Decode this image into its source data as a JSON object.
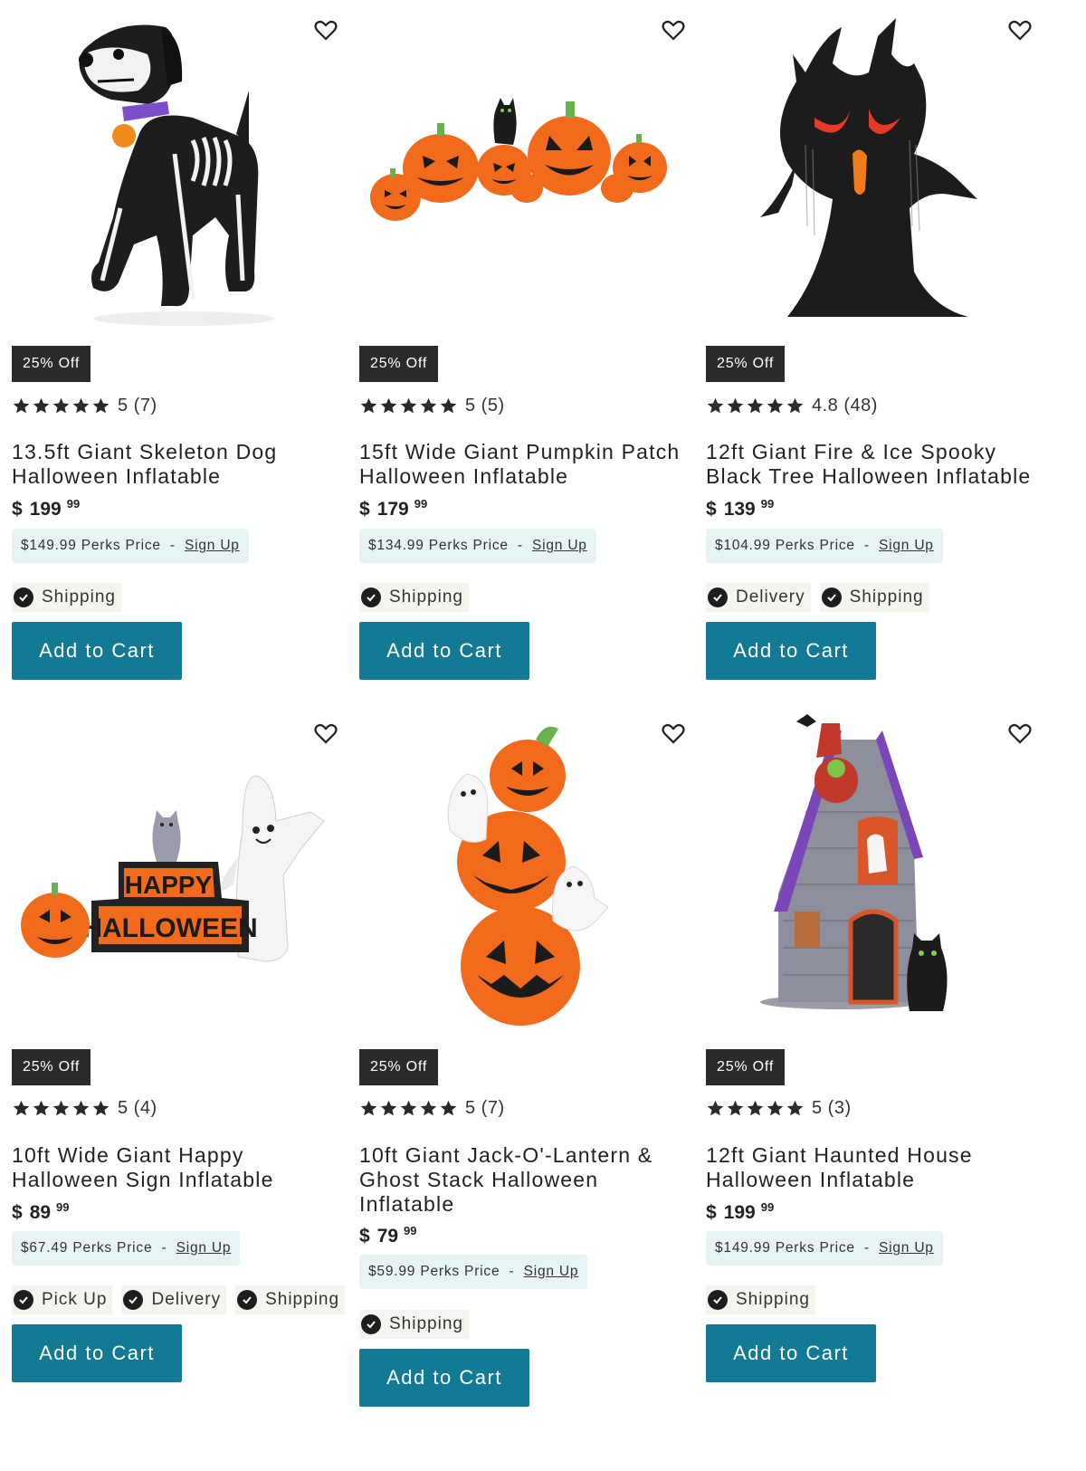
{
  "products": [
    {
      "image_alt": "skeleton dog",
      "badge": "25% Off",
      "rating": "5 (7)",
      "title": "13.5ft Giant Skeleton Dog Halloween Inflatable",
      "price": {
        "currency": "$",
        "dollars": "199",
        "cents": "99"
      },
      "perks": {
        "price": "$149.99",
        "label": "Perks Price",
        "separator": "-",
        "signup": "Sign Up"
      },
      "fulfillment": [
        "Shipping"
      ],
      "cta": "Add to Cart"
    },
    {
      "image_alt": "pumpkin patch",
      "badge": "25% Off",
      "rating": "5 (5)",
      "title": "15ft Wide Giant Pumpkin Patch Halloween Inflatable",
      "price": {
        "currency": "$",
        "dollars": "179",
        "cents": "99"
      },
      "perks": {
        "price": "$134.99",
        "label": "Perks Price",
        "separator": "-",
        "signup": "Sign Up"
      },
      "fulfillment": [
        "Shipping"
      ],
      "cta": "Add to Cart"
    },
    {
      "image_alt": "spooky tree",
      "badge": "25% Off",
      "rating": "4.8 (48)",
      "title": "12ft Giant Fire & Ice Spooky Black Tree Halloween Inflatable",
      "price": {
        "currency": "$",
        "dollars": "139",
        "cents": "99"
      },
      "perks": {
        "price": "$104.99",
        "label": "Perks Price",
        "separator": "-",
        "signup": "Sign Up"
      },
      "fulfillment": [
        "Delivery",
        "Shipping"
      ],
      "cta": "Add to Cart"
    },
    {
      "image_alt": "happy halloween sign",
      "badge": "25% Off",
      "rating": "5 (4)",
      "title": "10ft Wide Giant Happy Halloween Sign Inflatable",
      "price": {
        "currency": "$",
        "dollars": "89",
        "cents": "99"
      },
      "perks": {
        "price": "$67.49",
        "label": "Perks Price",
        "separator": "-",
        "signup": "Sign Up"
      },
      "fulfillment": [
        "Pick Up",
        "Delivery",
        "Shipping"
      ],
      "cta": "Add to Cart"
    },
    {
      "image_alt": "jack-o-lantern ghost stack",
      "badge": "25% Off",
      "rating": "5 (7)",
      "title": "10ft Giant Jack-O'-Lantern & Ghost Stack Halloween Inflatable",
      "price": {
        "currency": "$",
        "dollars": "79",
        "cents": "99"
      },
      "perks": {
        "price": "$59.99",
        "label": "Perks Price",
        "separator": "-",
        "signup": "Sign Up"
      },
      "fulfillment": [
        "Shipping"
      ],
      "cta": "Add to Cart"
    },
    {
      "image_alt": "haunted house",
      "badge": "25% Off",
      "rating": "5 (3)",
      "title": "12ft Giant Haunted House Halloween Inflatable",
      "price": {
        "currency": "$",
        "dollars": "199",
        "cents": "99"
      },
      "perks": {
        "price": "$149.99",
        "label": "Perks Price",
        "separator": "-",
        "signup": "Sign Up"
      },
      "fulfillment": [
        "Shipping"
      ],
      "cta": "Add to Cart"
    }
  ],
  "sign_text": {
    "line1": "HAPPY",
    "line2": "HALLOWEEN"
  },
  "colors": {
    "button": "#137a96",
    "badge": "#2b2b2b",
    "perks_bg": "#e8f3f5",
    "chip_bg": "#f5f5f0",
    "pumpkin": "#f26a1b"
  },
  "icons": {
    "wishlist": "heart-icon",
    "rating": "star-icon",
    "fulfillment": "check-circle-icon"
  }
}
